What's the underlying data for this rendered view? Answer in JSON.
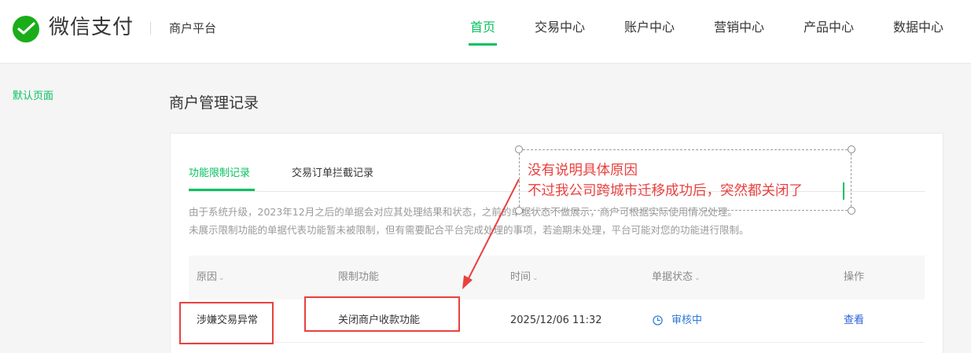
{
  "header": {
    "brand": "微信支付",
    "platform": "商户平台",
    "nav": [
      {
        "label": "首页",
        "active": true
      },
      {
        "label": "交易中心",
        "active": false
      },
      {
        "label": "账户中心",
        "active": false
      },
      {
        "label": "营销中心",
        "active": false
      },
      {
        "label": "产品中心",
        "active": false
      },
      {
        "label": "数据中心",
        "active": false
      }
    ]
  },
  "sidebar": {
    "items": [
      {
        "label": "默认页面",
        "active": true
      }
    ]
  },
  "main": {
    "title": "商户管理记录",
    "tabs": [
      {
        "label": "功能限制记录",
        "active": true
      },
      {
        "label": "交易订单拦截记录",
        "active": false
      }
    ],
    "notice": [
      "由于系统升级，2023年12月之后的单据会对应其处理结果和状态，之前的单据状态不做展示，商户可根据实际使用情况处理。",
      "未展示限制功能的单据代表功能暂未被限制，但有需要配合平台完成处理的事项，若逾期未处理，平台可能对您的功能进行限制。"
    ],
    "table": {
      "columns": [
        "原因",
        "限制功能",
        "时间",
        "单据状态",
        "操作"
      ],
      "rows": [
        {
          "reason": "涉嫌交易异常",
          "function": "关闭商户收款功能",
          "time": "2025/12/06 11:32",
          "status": "审核中",
          "action": "查看"
        }
      ]
    }
  },
  "annotation": {
    "lines": [
      "没有说明具体原因",
      "不过我公司跨城市迁移成功后，突然都关闭了"
    ],
    "color": "#e8413f"
  },
  "colors": {
    "brand_green": "#07c160",
    "link_blue": "#2b5fd6",
    "status_blue": "#2b79d6",
    "annotation_red": "#e8413f"
  },
  "icons": [
    "wechat-pay-logo",
    "chevron-down-icon",
    "clock-icon",
    "arrow-annotation"
  ]
}
